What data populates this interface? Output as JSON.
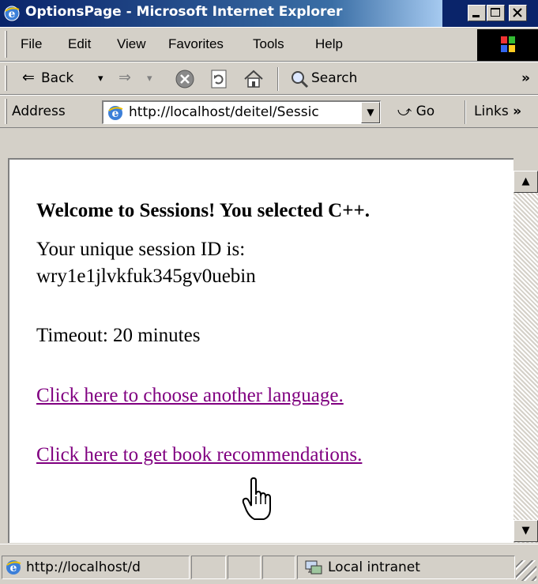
{
  "window": {
    "title": "OptionsPage - Microsoft Internet Explorer",
    "controls": {
      "minimize": "_",
      "maximize": "□",
      "close": "×"
    }
  },
  "menu": [
    "File",
    "Edit",
    "View",
    "Favorites",
    "Tools",
    "Help"
  ],
  "toolbar": {
    "back_label": "Back",
    "back_dropdown": "▾",
    "forward_arrow": "⇒",
    "forward_dropdown": "▾",
    "search_label": "Search",
    "overflow": "»"
  },
  "address": {
    "label": "Address",
    "url": "http://localhost/deitel/Sessic",
    "go_label": "Go",
    "links_label": "Links",
    "links_overflow": "»",
    "dropdown_arrow": "▼"
  },
  "page": {
    "heading": "Welcome to Sessions! You selected C++.",
    "session_label": "Your unique session ID is:",
    "session_id": "wry1e1jlvkfuk345gv0uebin",
    "timeout": "Timeout: 20 minutes",
    "link_language": "Click here to choose another language.",
    "link_recommendations": "Click here to get book recommendations."
  },
  "scrollbar": {
    "up_arrow": "▲",
    "down_arrow": "▼"
  },
  "status": {
    "url": "http://localhost/d",
    "zone": "Local intranet"
  },
  "icons": [
    "ie-logo-icon",
    "windows-logo-icon",
    "back-arrow-icon",
    "forward-arrow-icon",
    "stop-icon",
    "refresh-icon",
    "home-icon",
    "search-icon",
    "page-icon",
    "go-arrow-icon",
    "intranet-icon",
    "hand-cursor-icon",
    "resize-grip-icon"
  ],
  "colors": {
    "titlebar": "#0a246a",
    "chrome": "#d4d0c8",
    "visited_link": "#800080",
    "page_bg": "#ffffff"
  }
}
